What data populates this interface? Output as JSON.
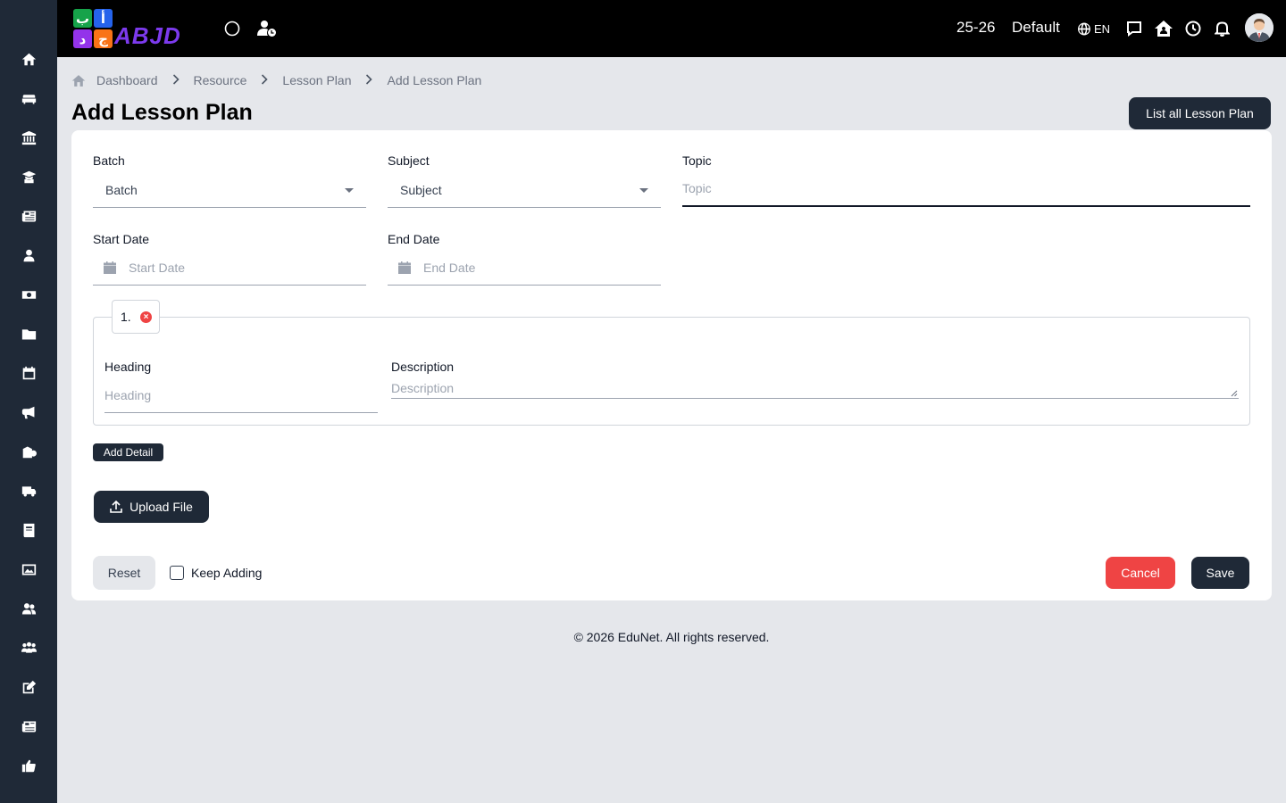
{
  "sidebar": {
    "items": [
      {
        "icon": "home-icon"
      },
      {
        "icon": "sofa-icon"
      },
      {
        "icon": "institution-icon"
      },
      {
        "icon": "graduate-icon"
      },
      {
        "icon": "newspaper-icon"
      },
      {
        "icon": "user-icon"
      },
      {
        "icon": "money-icon"
      },
      {
        "icon": "folder-icon"
      },
      {
        "icon": "calendar-icon"
      },
      {
        "icon": "megaphone-icon"
      },
      {
        "icon": "building-icon"
      },
      {
        "icon": "truck-icon"
      },
      {
        "icon": "book-icon"
      },
      {
        "icon": "image-icon"
      },
      {
        "icon": "users-icon"
      },
      {
        "icon": "people-group-icon"
      },
      {
        "icon": "edit-icon"
      },
      {
        "icon": "news-icon"
      },
      {
        "icon": "thumbs-up-icon"
      }
    ]
  },
  "header": {
    "logo_letters": [
      "ب",
      "أ",
      "ج",
      "د"
    ],
    "logo_word": "ABJD",
    "session": "25-26",
    "profile": "Default",
    "language": "EN"
  },
  "breadcrumb": {
    "items": [
      "Dashboard",
      "Resource",
      "Lesson Plan",
      "Add Lesson Plan"
    ]
  },
  "page": {
    "title": "Add Lesson Plan",
    "list_button": "List all Lesson Plan"
  },
  "form": {
    "batch": {
      "label": "Batch",
      "value": "Batch"
    },
    "subject": {
      "label": "Subject",
      "value": "Subject"
    },
    "topic": {
      "label": "Topic",
      "placeholder": "Topic"
    },
    "start_date": {
      "label": "Start Date",
      "placeholder": "Start Date"
    },
    "end_date": {
      "label": "End Date",
      "placeholder": "End Date"
    },
    "detail": {
      "number": "1.",
      "heading_label": "Heading",
      "heading_placeholder": "Heading",
      "description_label": "Description",
      "description_placeholder": "Description"
    },
    "add_detail": "Add Detail",
    "upload": "Upload File",
    "reset": "Reset",
    "keep_adding": "Keep Adding",
    "cancel": "Cancel",
    "save": "Save"
  },
  "footer": {
    "text": "© 2026 EduNet. All rights reserved."
  },
  "colors": {
    "sidebar_bg": "#1f2937",
    "header_bg": "#000000",
    "primary": "#1f2937",
    "danger": "#ef4444",
    "page_bg": "#e5e7eb"
  }
}
